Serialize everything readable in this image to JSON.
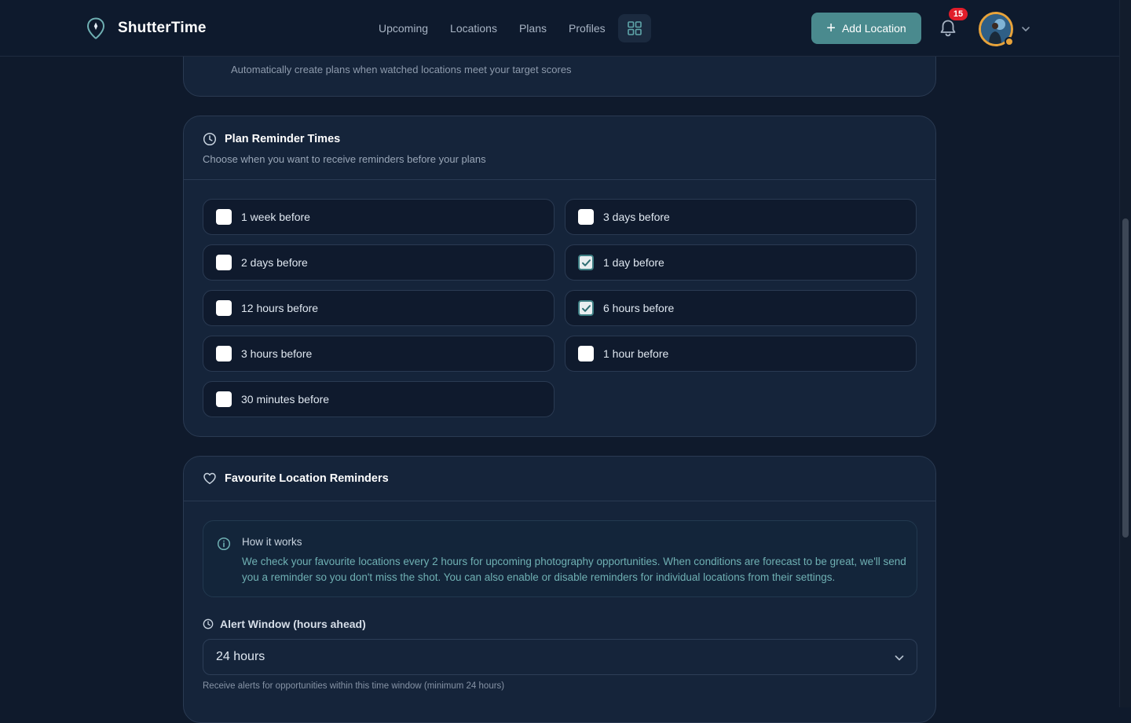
{
  "header": {
    "brand": "ShutterTime",
    "nav": [
      "Upcoming",
      "Locations",
      "Plans",
      "Profiles"
    ],
    "add_location": "Add Location",
    "notification_count": "15"
  },
  "auto_plans": {
    "description": "Automatically create plans when watched locations meet your target scores"
  },
  "plan_reminders": {
    "title": "Plan Reminder Times",
    "subtitle": "Choose when you want to receive reminders before your plans",
    "options": [
      {
        "label": "1 week before",
        "checked": false
      },
      {
        "label": "3 days before",
        "checked": false
      },
      {
        "label": "2 days before",
        "checked": false
      },
      {
        "label": "1 day before",
        "checked": true
      },
      {
        "label": "12 hours before",
        "checked": false
      },
      {
        "label": "6 hours before",
        "checked": true
      },
      {
        "label": "3 hours before",
        "checked": false
      },
      {
        "label": "1 hour before",
        "checked": false
      },
      {
        "label": "30 minutes before",
        "checked": false
      }
    ]
  },
  "favourite_reminders": {
    "title": "Favourite Location Reminders",
    "info_title": "How it works",
    "info_text": "We check your favourite locations every 2 hours for upcoming photography opportunities. When conditions are forecast to be great, we'll send you a reminder so you don't miss the shot. You can also enable or disable reminders for individual locations from their settings.",
    "alert_window_label": "Alert Window (hours ahead)",
    "alert_window_value": "24 hours",
    "alert_window_help": "Receive alerts for opportunities within this time window (minimum 24 hours)"
  },
  "colors": {
    "accent": "#4a8a8e",
    "background": "#0f1a2c",
    "card": "#15243a",
    "badge": "#e11d2a"
  }
}
